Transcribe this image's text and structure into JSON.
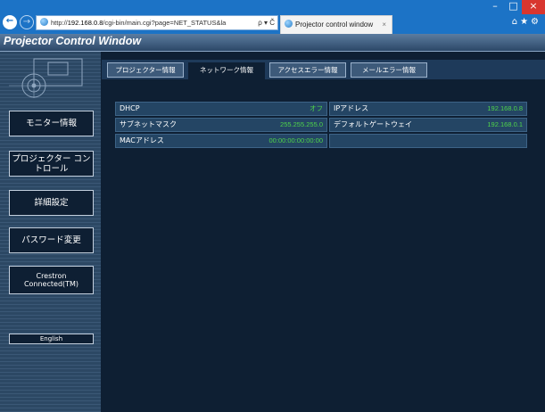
{
  "browser": {
    "url_prefix": "http://",
    "url_host": "192.168.0.8",
    "url_path": "/cgi-bin/main.cgi?page=NET_STATUS&la",
    "address_tools": "ρ ▾ Č",
    "tab_title": "Projector control window",
    "tab_close": "×",
    "win_min": "–",
    "win_max": "□",
    "win_close": "×",
    "nav_back": "←",
    "nav_fwd": "→",
    "toolbar_icons": "⌂★⚙"
  },
  "app": {
    "title": "Projector Control Window"
  },
  "sidebar": {
    "buttons": [
      {
        "label": "モニター情報"
      },
      {
        "label": "プロジェクター コントロール"
      },
      {
        "label": "詳細設定"
      },
      {
        "label": "パスワード変更"
      },
      {
        "label": "Crestron Connected(TM)"
      }
    ],
    "language_button": "English"
  },
  "tabs": [
    {
      "label": "プロジェクター情報",
      "active": false
    },
    {
      "label": "ネットワーク情報",
      "active": true
    },
    {
      "label": "アクセスエラー情報",
      "active": false
    },
    {
      "label": "メールエラー情報",
      "active": false
    }
  ],
  "network": {
    "rows": [
      {
        "left_label": "DHCP",
        "left_value": "オフ",
        "right_label": "IPアドレス",
        "right_value": "192.168.0.8"
      },
      {
        "left_label": "サブネットマスク",
        "left_value": "255.255.255.0",
        "right_label": "デフォルトゲートウェイ",
        "right_value": "192.168.0.1"
      },
      {
        "left_label": "MACアドレス",
        "left_value": "00:00:00:00:00:00",
        "right_label": "",
        "right_value": ""
      }
    ]
  },
  "colors": {
    "value_green": "#4fd44a",
    "page_bg": "#0e1f33",
    "chrome_blue": "#1c73c6"
  }
}
